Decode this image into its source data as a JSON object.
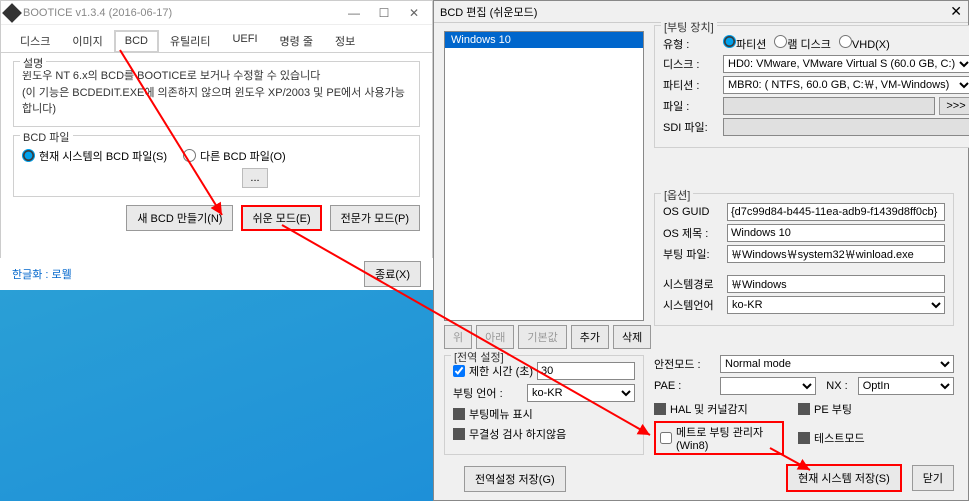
{
  "left": {
    "title": "BOOTICE v1.3.4 (2016-06-17)",
    "tabs": [
      "디스크",
      "이미지",
      "BCD",
      "유틸리티",
      "UEFI",
      "명령 줄",
      "정보"
    ],
    "active_tab_index": 2,
    "desc_label": "설명",
    "desc_line1": "윈도우 NT 6.x의 BCD를 BOOTICE로 보거나 수정할 수 있습니다",
    "desc_line2": "(이 기능은 BCDEDIT.EXE에 의존하지 않으며 윈도우 XP/2003 및 PE에서 사용가능합니다)",
    "bcd_label": "BCD 파일",
    "radio_cur": "현재 시스템의 BCD 파일(S)",
    "radio_other": "다른 BCD 파일(O)",
    "btn_new": "새 BCD 만들기(N)",
    "btn_easy": "쉬운 모드(E)",
    "btn_pro": "전문가 모드(P)",
    "hangul": "한글화 : 로웰",
    "close": "종료(X)"
  },
  "right": {
    "title": "BCD 편집 (쉬운모드)",
    "list_item": "Windows 10",
    "btn_up": "위",
    "btn_down": "아래",
    "btn_def": "기본값",
    "btn_add": "추가",
    "btn_del": "삭제",
    "boot_label": "[부팅 장치]",
    "type_lbl": "유형 :",
    "type_part": "파티션",
    "type_ram": "램 디스크",
    "type_vhd": "VHD(X)",
    "disk_lbl": "디스크 :",
    "disk_val": "HD0: VMware, VMware Virtual S (60.0 GB, C:)",
    "part_lbl": "파티션 :",
    "part_val": "MBR0: ( NTFS,  60.0 GB, C:￦, VM-Windows)",
    "file_lbl": "파일 :",
    "gbtn": ">>>",
    "sdi_lbl": "SDI 파일:",
    "opt_label": "[옵션]",
    "guid_lbl": "OS GUID",
    "guid_val": "{d7c99d84-b445-11ea-adb9-f1439d8ff0cb}",
    "title_lbl": "OS 제목 :",
    "title_val": "Windows 10",
    "bootf_lbl": "부팅 파일:",
    "bootf_val": "￦Windows￦system32￦winload.exe",
    "sysp_lbl": "시스템경로",
    "sysp_val": "￦Windows",
    "lang_lbl": "시스템언어",
    "lang_val": "ko-KR",
    "global_label": "[전역 설정]",
    "limit_lbl": "제한 시간 (초)",
    "limit_val": "30",
    "bootlang_lbl": "부팅 언어 :",
    "bootlang_val": "ko-KR",
    "cb_menu": "부팅메뉴 표시",
    "cb_integ": "무결성 검사 하지않음",
    "safe_lbl": "안전모드 :",
    "safe_val": "Normal mode",
    "pae_lbl": "PAE :",
    "nx_lbl": "NX :",
    "nx_val": "OptIn",
    "cb_hal": "HAL 및 커널감지",
    "cb_pe": "PE 부팅",
    "cb_metro": "메트로 부팅 관리자(Win8)",
    "cb_test": "테스트모드",
    "save_global": "전역설정 저장(G)",
    "save_cur": "현재 시스템 저장(S)",
    "close": "닫기"
  }
}
